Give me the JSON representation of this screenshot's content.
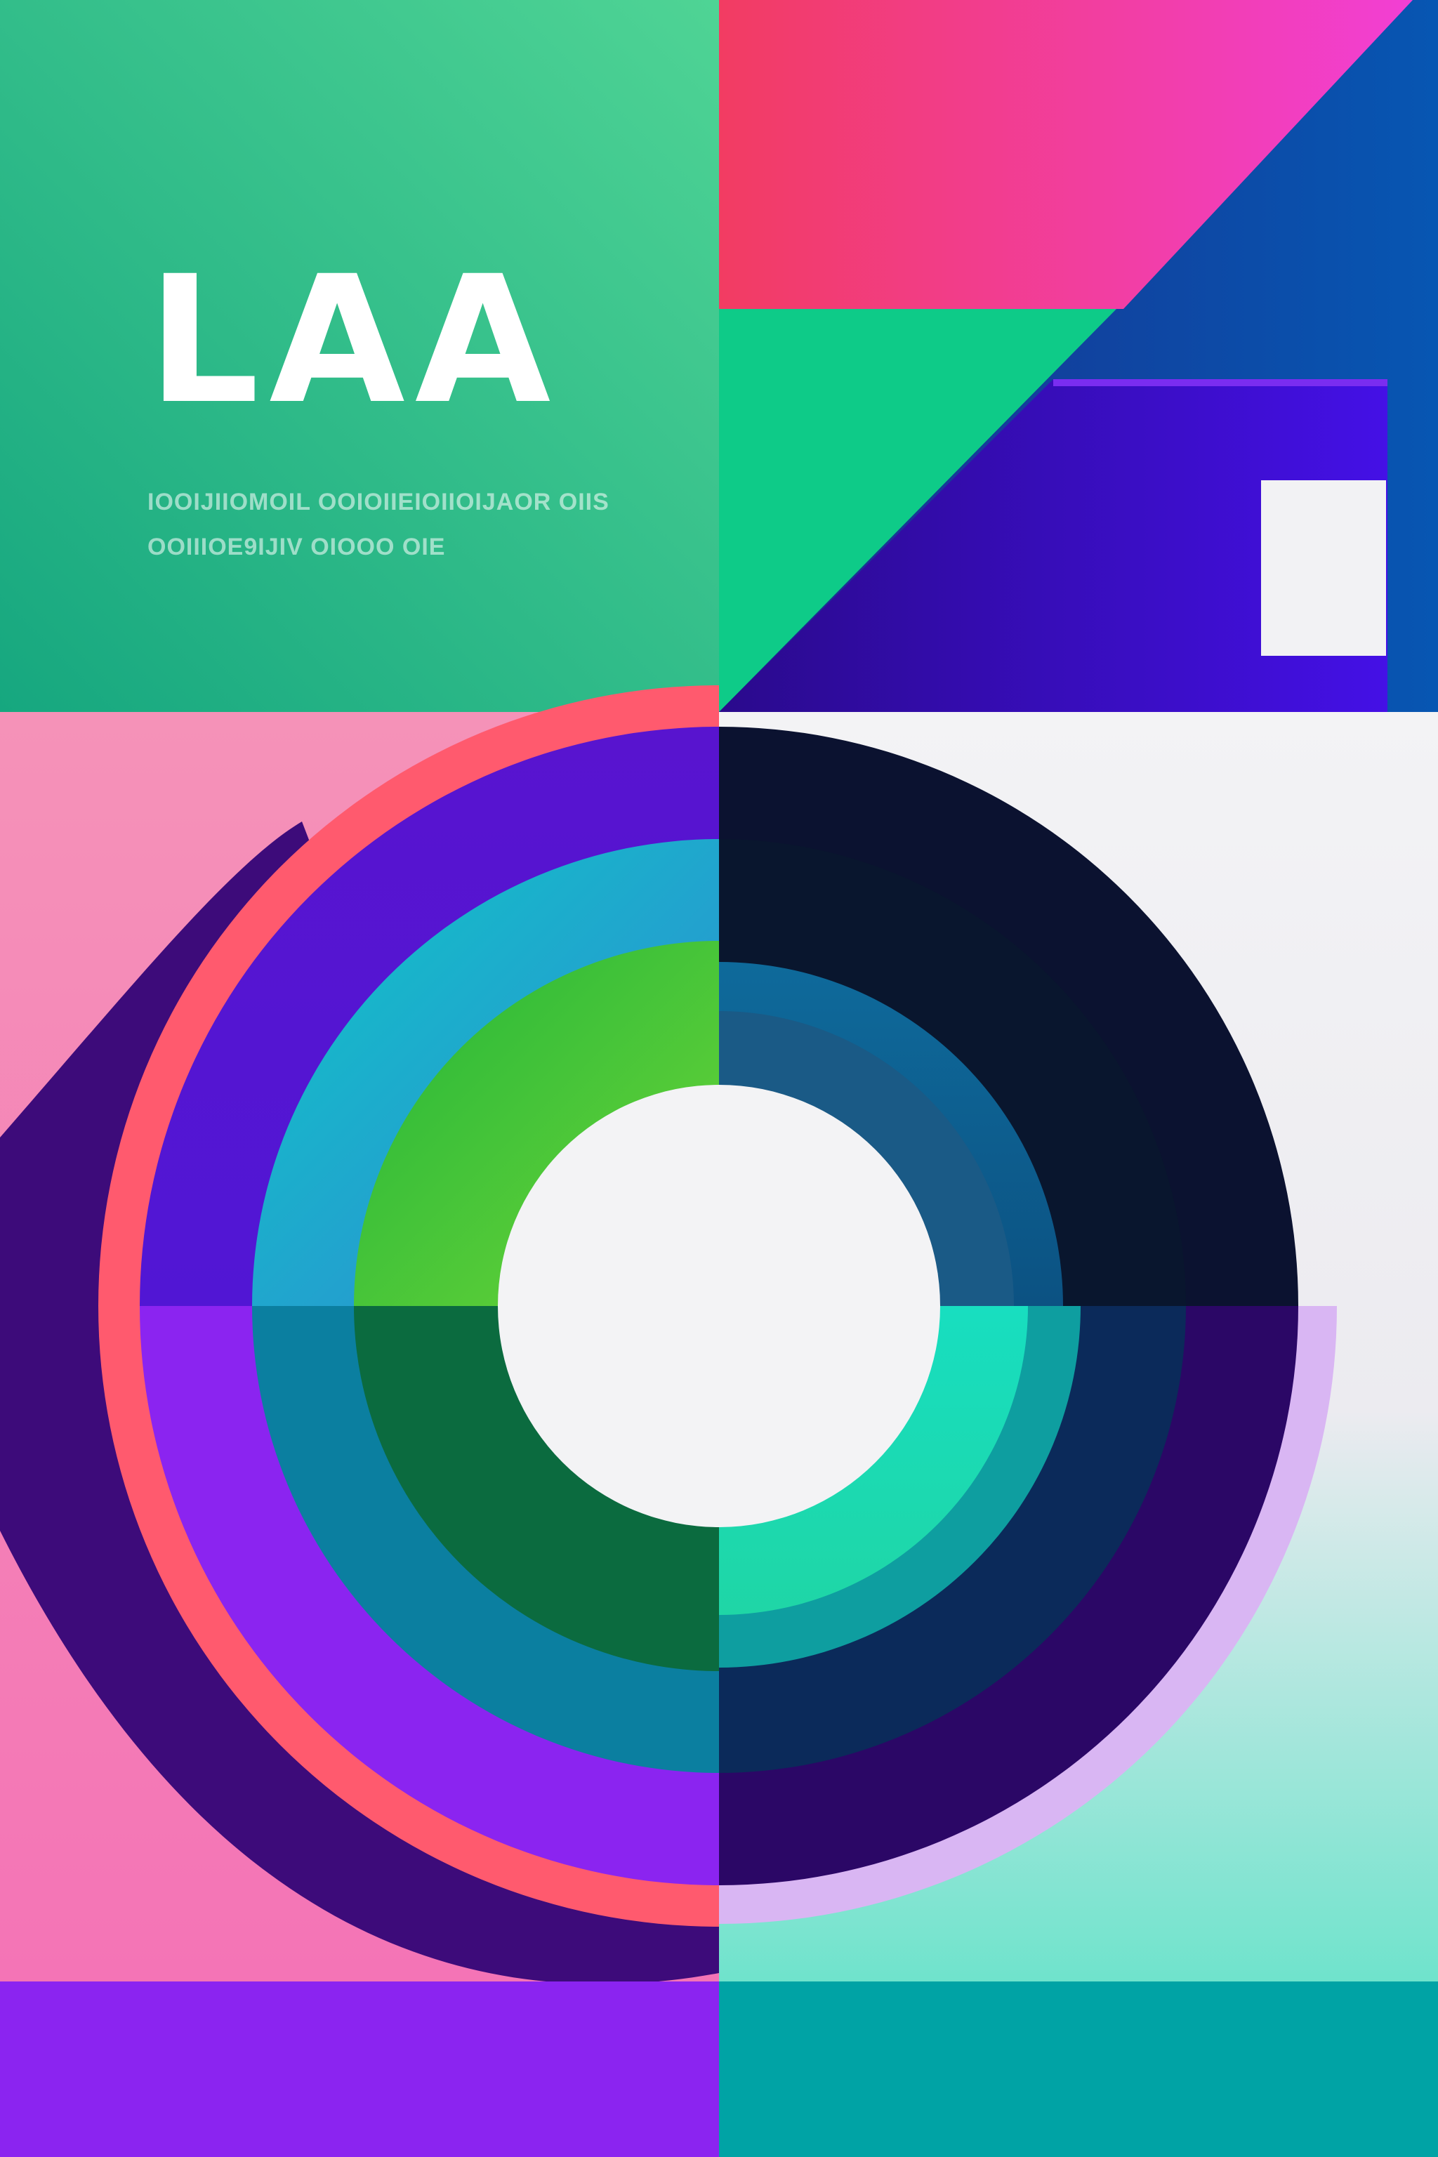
{
  "poster": {
    "title": "LAA",
    "subtitle_lines": [
      "IOOIJIIOMOIL OOIOIIEIOIIOIJAOR OIIS",
      "OOIIIOE9IJIV OIOOO OIE"
    ]
  },
  "colors": {
    "green_panel": "#2fbd8e",
    "magenta_pink": "#f03a6a",
    "navy_blue": "#0a4fa5",
    "emerald": "#0ecb88",
    "indigo": "#3b0fd9",
    "pink_panel": "#f47fb6",
    "white": "#f3f3f5",
    "violet_ring": "#5a1ad8",
    "dark_navy": "#0b1230",
    "coral_ring": "#ff5a6e",
    "teal_ring": "#0b8aa0",
    "lime_green": "#a8f23a",
    "forest_green": "#0b6b3f",
    "cyan": "#11e8d8",
    "purple_band": "#8b24f0",
    "teal_band": "#00a3a5"
  }
}
